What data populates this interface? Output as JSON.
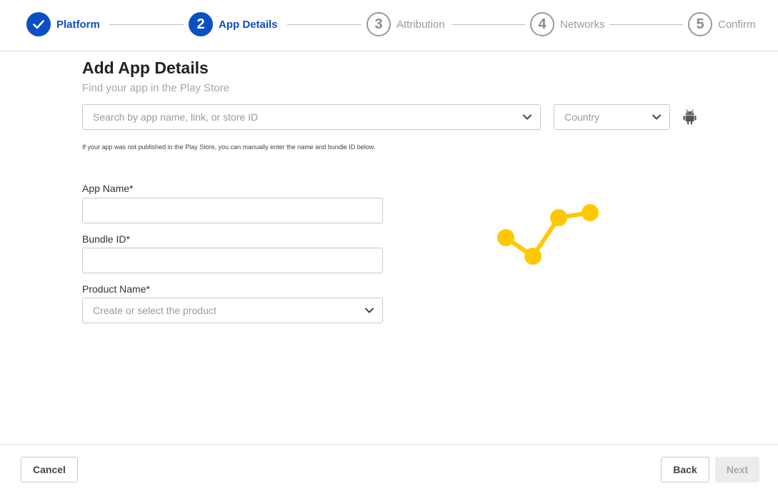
{
  "stepper": {
    "steps": [
      {
        "number": "",
        "label": "Platform",
        "state": "done"
      },
      {
        "number": "2",
        "label": "App Details",
        "state": "active"
      },
      {
        "number": "3",
        "label": "Attribution",
        "state": "pending"
      },
      {
        "number": "4",
        "label": "Networks",
        "state": "pending"
      },
      {
        "number": "5",
        "label": "Confirm",
        "state": "pending"
      }
    ]
  },
  "main": {
    "title": "Add App Details",
    "subtitle": "Find your app in the Play Store",
    "search": {
      "placeholder": "Search by app name, link, or store ID"
    },
    "country": {
      "placeholder": "Country"
    },
    "store_icon": "android-icon",
    "hint": "If your app was not published in the Play Store, you can manually enter the name and bundle ID below.",
    "fields": {
      "app_name": {
        "label": "App Name*",
        "value": ""
      },
      "bundle_id": {
        "label": "Bundle ID*",
        "value": ""
      },
      "product_name": {
        "label": "Product Name*",
        "placeholder": "Create or select the product"
      }
    }
  },
  "footer": {
    "cancel_label": "Cancel",
    "back_label": "Back",
    "next_label": "Next"
  },
  "colors": {
    "accent": "#0b4fc4",
    "loader": "#ffc800",
    "pending": "#9a9a9a"
  }
}
